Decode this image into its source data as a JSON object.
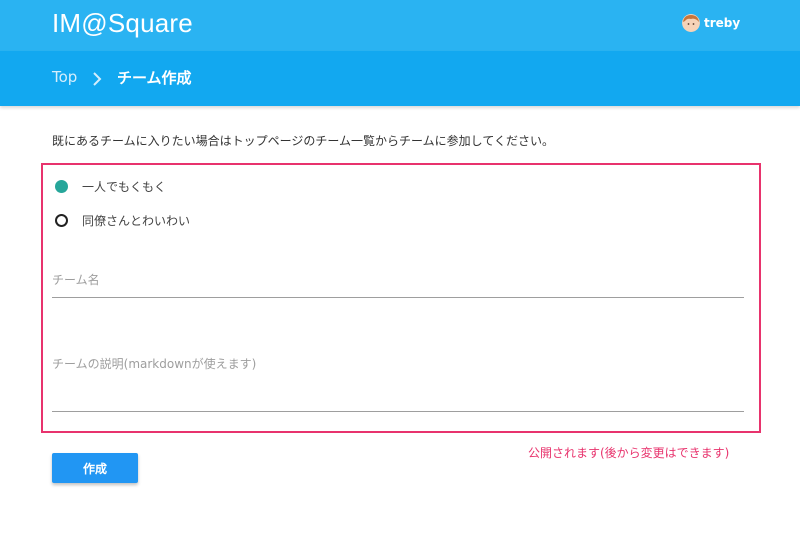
{
  "app": {
    "title": "IM@Square"
  },
  "user": {
    "name": "treby"
  },
  "breadcrumb": {
    "root": "Top",
    "current": "チーム作成"
  },
  "intro_text": "既にあるチームに入りたい場合はトップページのチーム一覧からチームに参加してください。",
  "team_type": {
    "options": [
      {
        "label": "一人でもくもく",
        "selected": true
      },
      {
        "label": "同僚さんとわいわい",
        "selected": false
      }
    ]
  },
  "fields": {
    "team_name": {
      "label": "チーム名",
      "value": ""
    },
    "description": {
      "label": "チームの説明(markdownが使えます)",
      "value": ""
    }
  },
  "create_button": {
    "label": "作成"
  },
  "annotation": {
    "text": "公開されます(後から変更はできます)",
    "color": "#e8336d"
  },
  "colors": {
    "appbar": "#2ab3f2",
    "crumbbar": "#12a8f0",
    "accent": "#2196f3",
    "radio_checked": "#26a69a"
  }
}
